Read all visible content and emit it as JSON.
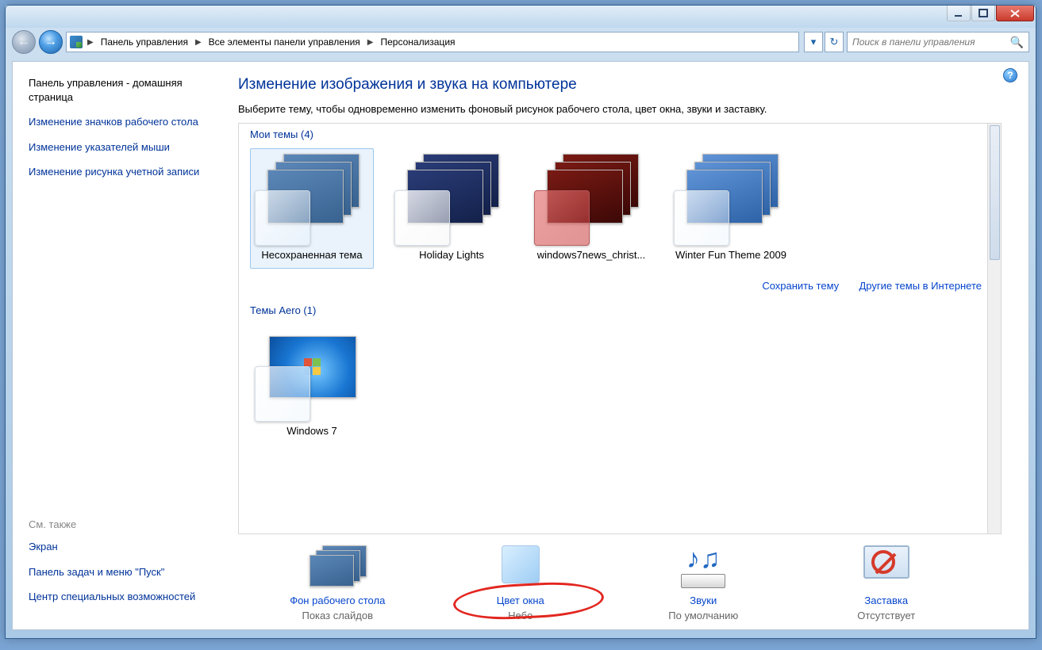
{
  "breadcrumb": {
    "items": [
      "Панель управления",
      "Все элементы панели управления",
      "Персонализация"
    ]
  },
  "search": {
    "placeholder": "Поиск в панели управления"
  },
  "sidebar": {
    "home": "Панель управления - домашняя страница",
    "links": [
      "Изменение значков рабочего стола",
      "Изменение указателей мыши",
      "Изменение рисунка учетной записи"
    ],
    "see_also_title": "См. также",
    "see_also": [
      "Экран",
      "Панель задач и меню \"Пуск\"",
      "Центр специальных возможностей"
    ]
  },
  "main": {
    "title": "Изменение изображения и звука на компьютере",
    "desc": "Выберите тему, чтобы одновременно изменить фоновый рисунок рабочего стола, цвет окна, звуки и заставку.",
    "my_themes_label": "Мои темы (4)",
    "my_themes": [
      {
        "name": "Несохраненная тема",
        "fill": "fill-blue",
        "glass": "glass-sq",
        "selected": true
      },
      {
        "name": "Holiday Lights",
        "fill": "fill-holiday",
        "glass": "glass-sq white"
      },
      {
        "name": "windows7news_christ...",
        "fill": "fill-red",
        "glass": "glass-sq red"
      },
      {
        "name": "Winter Fun Theme 2009",
        "fill": "fill-winter",
        "glass": "glass-sq"
      }
    ],
    "save_theme": "Сохранить тему",
    "more_themes": "Другие темы в Интернете",
    "aero_label": "Темы Aero (1)",
    "aero_themes": [
      {
        "name": "Windows 7"
      }
    ],
    "bottom": [
      {
        "link": "Фон рабочего стола",
        "sub": "Показ слайдов"
      },
      {
        "link": "Цвет окна",
        "sub": "Небо"
      },
      {
        "link": "Звуки",
        "sub": "По умолчанию"
      },
      {
        "link": "Заставка",
        "sub": "Отсутствует"
      }
    ]
  }
}
